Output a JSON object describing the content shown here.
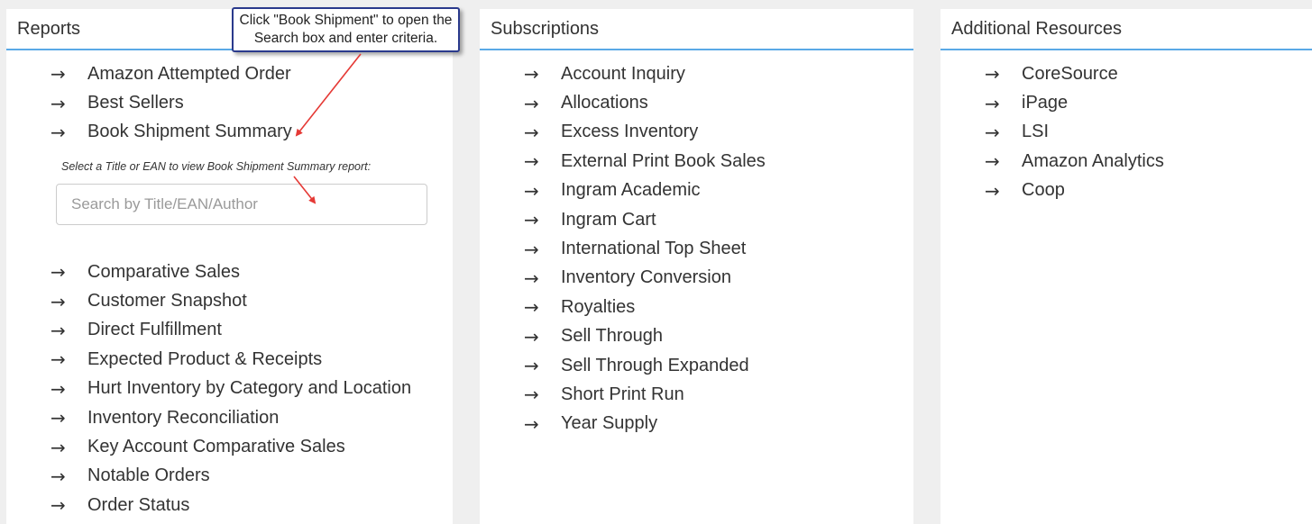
{
  "panels": {
    "reports": {
      "title": "Reports",
      "items_top": [
        {
          "label": "Amazon Attempted Order"
        },
        {
          "label": "Best Sellers"
        },
        {
          "label": "Book Shipment Summary"
        }
      ],
      "hint": "Select a Title or EAN to view Book Shipment Summary report:",
      "search_placeholder": "Search by Title/EAN/Author",
      "items_bottom": [
        {
          "label": "Comparative Sales"
        },
        {
          "label": "Customer Snapshot"
        },
        {
          "label": "Direct Fulfillment"
        },
        {
          "label": "Expected Product & Receipts"
        },
        {
          "label": "Hurt Inventory by Category and Location"
        },
        {
          "label": "Inventory Reconciliation"
        },
        {
          "label": "Key Account Comparative Sales"
        },
        {
          "label": "Notable Orders"
        },
        {
          "label": "Order Status"
        }
      ]
    },
    "subscriptions": {
      "title": "Subscriptions",
      "items": [
        {
          "label": "Account Inquiry"
        },
        {
          "label": "Allocations"
        },
        {
          "label": "Excess Inventory"
        },
        {
          "label": "External Print Book Sales"
        },
        {
          "label": "Ingram Academic"
        },
        {
          "label": "Ingram Cart"
        },
        {
          "label": "International Top Sheet"
        },
        {
          "label": "Inventory Conversion"
        },
        {
          "label": "Royalties"
        },
        {
          "label": "Sell Through"
        },
        {
          "label": "Sell Through Expanded"
        },
        {
          "label": "Short Print Run"
        },
        {
          "label": "Year Supply"
        }
      ]
    },
    "resources": {
      "title": "Additional Resources",
      "items": [
        {
          "label": "CoreSource"
        },
        {
          "label": "iPage"
        },
        {
          "label": "LSI"
        },
        {
          "label": "Amazon Analytics"
        },
        {
          "label": "Coop"
        }
      ]
    }
  },
  "arrow_glyph": "→",
  "callout": {
    "line1": "Click \"Book Shipment\" to open the",
    "line2": "Search box and enter criteria."
  },
  "colors": {
    "header_rule": "#5aa9e6",
    "callout_border": "#2a3a8c",
    "annotation_arrow": "#e53935"
  }
}
